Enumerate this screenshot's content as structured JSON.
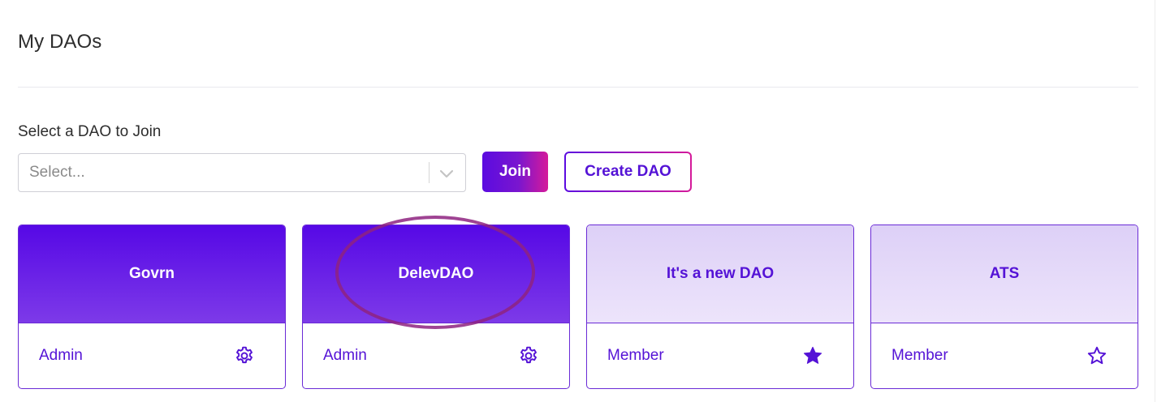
{
  "header": {
    "title": "My DAOs"
  },
  "join_section": {
    "label": "Select a DAO to Join",
    "select": {
      "placeholder": "Select...",
      "value": ""
    },
    "join_label": "Join",
    "create_label": "Create DAO"
  },
  "daos": [
    {
      "name": "Govrn",
      "role": "Admin",
      "icon": "gear-icon",
      "style": "dark"
    },
    {
      "name": "DelevDAO",
      "role": "Admin",
      "icon": "gear-icon",
      "style": "dark"
    },
    {
      "name": "It's a new DAO",
      "role": "Member",
      "icon": "star-filled-icon",
      "style": "light"
    },
    {
      "name": "ATS",
      "role": "Member",
      "icon": "star-outline-icon",
      "style": "light"
    }
  ],
  "colors": {
    "accent": "#5412d6",
    "gradient_start": "#5b0be0",
    "gradient_end": "#d51a9a",
    "highlight": "#8e2380"
  }
}
